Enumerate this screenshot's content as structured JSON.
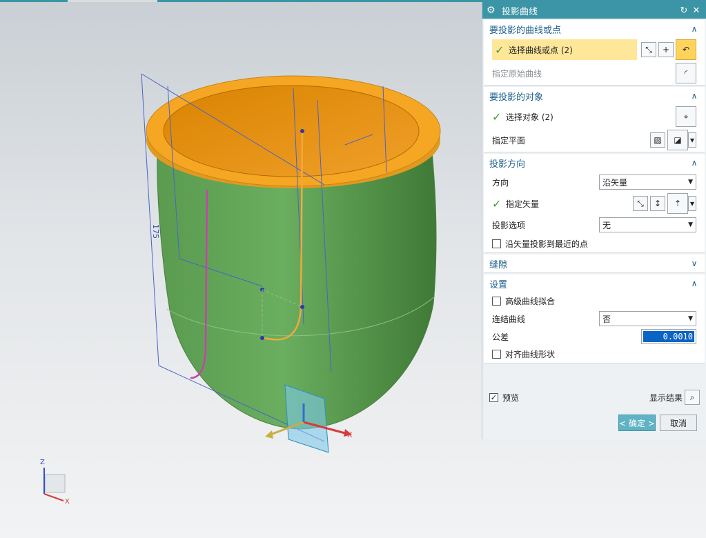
{
  "dialog": {
    "title": "投影曲线",
    "sections": {
      "curves": {
        "header": "要投影的曲线或点",
        "select_label": "选择曲线或点 (2)",
        "original_label": "指定原始曲线"
      },
      "objects": {
        "header": "要投影的对象",
        "select_label": "选择对象 (2)",
        "plane_label": "指定平面"
      },
      "direction": {
        "header": "投影方向",
        "direction_label": "方向",
        "direction_value": "沿矢量",
        "vector_label": "指定矢量",
        "option_label": "投影选项",
        "option_value": "无",
        "nearest_label": "沿矢量投影到最近的点"
      },
      "gap": {
        "header": "缝隙"
      },
      "settings": {
        "header": "设置",
        "advanced_fit_label": "高级曲线拟合",
        "join_label": "连结曲线",
        "join_value": "否",
        "tolerance_label": "公差",
        "tolerance_value": "0.0010",
        "align_label": "对齐曲线形状"
      }
    },
    "preview_label": "预览",
    "preview_checked": true,
    "show_result_label": "显示结果",
    "ok_label": "< 确定 >",
    "cancel_label": "取消"
  },
  "viewport": {
    "dimension_label": "175",
    "triad_axes": {
      "x": "X",
      "z": "Z"
    },
    "triad_small": {
      "z": "Z",
      "x": "X"
    }
  },
  "colors": {
    "accent": "#3b95a6",
    "body_green": "#5fa055",
    "rim_orange": "#f5a623",
    "curve_orange": "#f2a93b",
    "curve_magenta": "#c543a8",
    "highlight_yellow": "#ffe79a"
  }
}
